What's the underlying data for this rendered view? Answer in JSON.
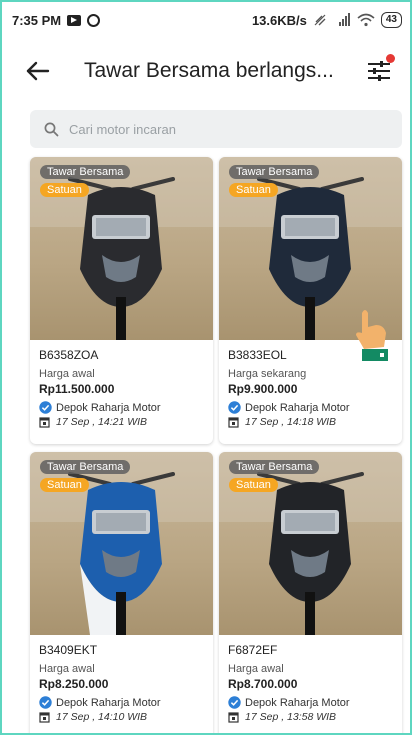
{
  "status_bar": {
    "time": "7:35 PM",
    "speed": "13.6KB/s",
    "battery": "43"
  },
  "app_bar": {
    "title": "Tawar Bersama berlangs..."
  },
  "search": {
    "placeholder": "Cari motor incaran"
  },
  "listings": [
    {
      "tag_auction": "Tawar Bersama",
      "tag_type": "Satuan",
      "plate": "B6358ZOA",
      "price_label": "Harga awal",
      "price": "Rp11.500.000",
      "dealer": "Depok Raharja Motor",
      "time": "17 Sep , 14:21 WIB",
      "bike_color": "#2a2b2f"
    },
    {
      "tag_auction": "Tawar Bersama",
      "tag_type": "Satuan",
      "plate": "B3833EOL",
      "price_label": "Harga sekarang",
      "price": "Rp9.900.000",
      "dealer": "Depok Raharja Motor",
      "time": "17 Sep , 14:18 WIB",
      "bike_color": "#1f2a3a"
    },
    {
      "tag_auction": "Tawar Bersama",
      "tag_type": "Satuan",
      "plate": "B3409EKT",
      "price_label": "Harga awal",
      "price": "Rp8.250.000",
      "dealer": "Depok Raharja Motor",
      "time": "17 Sep , 14:10 WIB",
      "bike_color": "#1d5fae"
    },
    {
      "tag_auction": "Tawar Bersama",
      "tag_type": "Satuan",
      "plate": "F6872EF",
      "price_label": "Harga awal",
      "price": "Rp8.700.000",
      "dealer": "Depok Raharja Motor",
      "time": "17 Sep , 13:58 WIB",
      "bike_color": "#222428"
    }
  ],
  "colors": {
    "accent": "#f5a623",
    "verified": "#2d7fd6",
    "frame": "#5ed6c0"
  }
}
